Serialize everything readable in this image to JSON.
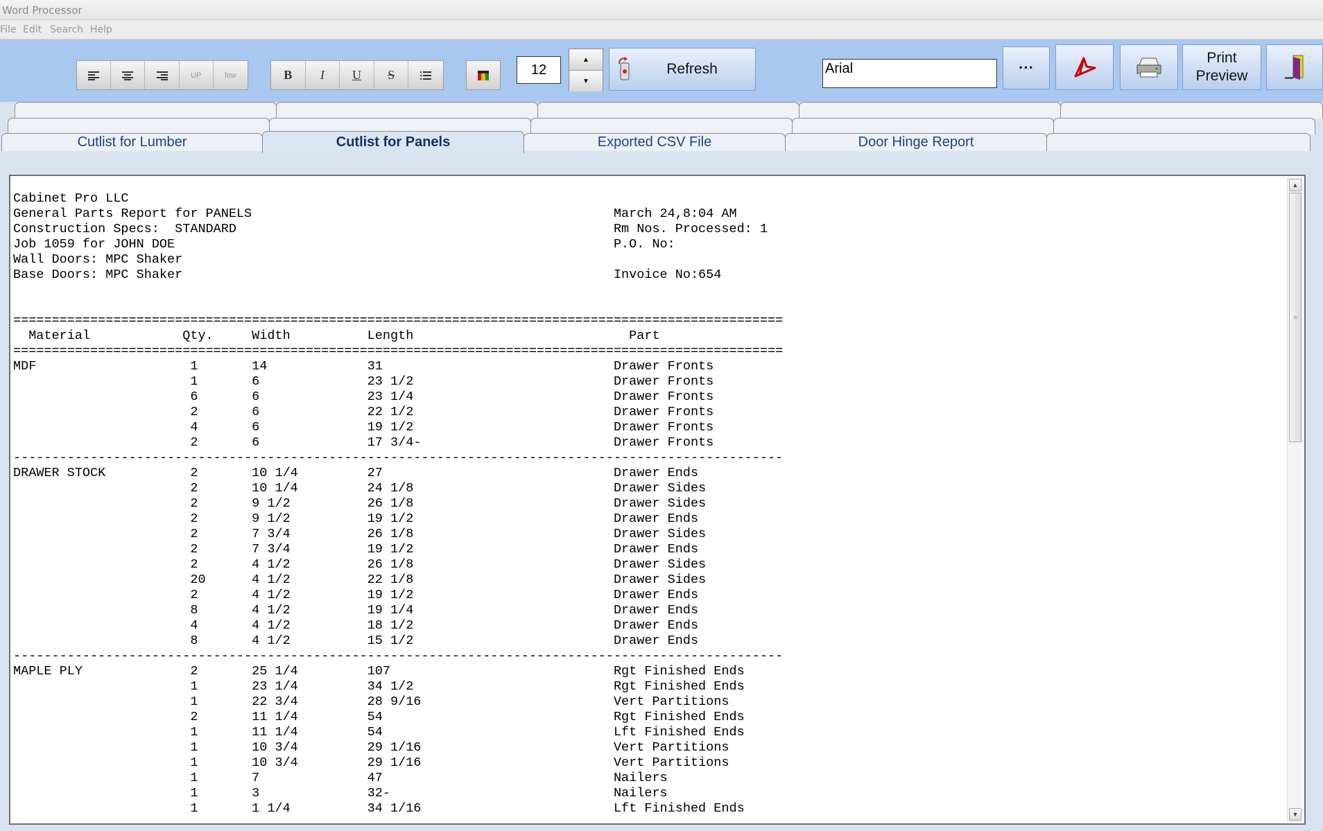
{
  "window": {
    "title": "Word Processor"
  },
  "menu": [
    "File",
    "Edit",
    "Search",
    "Help"
  ],
  "toolbar": {
    "align_buttons": [
      "align-left",
      "align-center",
      "align-right",
      "UP",
      "low"
    ],
    "style_buttons": [
      "B",
      "I",
      "U",
      "S",
      "list"
    ],
    "font_size": "12",
    "refresh_label": "Refresh",
    "font_name": "Arial",
    "more_label": "···",
    "print_preview_label": "Print\nPreview"
  },
  "tabs": {
    "labels": [
      "Cutlist for Lumber",
      "Cutlist for Panels",
      "Exported CSV File",
      "Door Hinge Report"
    ],
    "active": "Cutlist for Panels"
  },
  "report": {
    "header_left": [
      "Cabinet Pro LLC",
      "General Parts Report for PANELS",
      "Construction Specs:  STANDARD",
      "Job 1059 for JOHN DOE",
      "Wall Doors: MPC Shaker",
      "Base Doors: MPC Shaker"
    ],
    "date": "March 24,8:04 AM",
    "rooms_processed": "Rm Nos. Processed: 1",
    "po": "P.O. No:",
    "invoice": "Invoice No:654",
    "columns": [
      "Material",
      "Qty.",
      "Width",
      "Length",
      "Part"
    ],
    "groups": [
      {
        "material": "MDF",
        "rows": [
          [
            "1",
            "14",
            "31",
            "Drawer Fronts"
          ],
          [
            "1",
            "6",
            "23 1/2",
            "Drawer Fronts"
          ],
          [
            "6",
            "6",
            "23 1/4",
            "Drawer Fronts"
          ],
          [
            "2",
            "6",
            "22 1/2",
            "Drawer Fronts"
          ],
          [
            "4",
            "6",
            "19 1/2",
            "Drawer Fronts"
          ],
          [
            "2",
            "6",
            "17 3/4-",
            "Drawer Fronts"
          ]
        ]
      },
      {
        "material": "DRAWER STOCK",
        "rows": [
          [
            "2",
            "10 1/4",
            "27",
            "Drawer Ends"
          ],
          [
            "2",
            "10 1/4",
            "24 1/8",
            "Drawer Sides"
          ],
          [
            "2",
            "9 1/2",
            "26 1/8",
            "Drawer Sides"
          ],
          [
            "2",
            "9 1/2",
            "19 1/2",
            "Drawer Ends"
          ],
          [
            "2",
            "7 3/4",
            "26 1/8",
            "Drawer Sides"
          ],
          [
            "2",
            "7 3/4",
            "19 1/2",
            "Drawer Ends"
          ],
          [
            "2",
            "4 1/2",
            "26 1/8",
            "Drawer Sides"
          ],
          [
            "20",
            "4 1/2",
            "22 1/8",
            "Drawer Sides"
          ],
          [
            "2",
            "4 1/2",
            "19 1/2",
            "Drawer Ends"
          ],
          [
            "8",
            "4 1/2",
            "19 1/4",
            "Drawer Ends"
          ],
          [
            "4",
            "4 1/2",
            "18 1/2",
            "Drawer Ends"
          ],
          [
            "8",
            "4 1/2",
            "15 1/2",
            "Drawer Ends"
          ]
        ]
      },
      {
        "material": "MAPLE PLY",
        "rows": [
          [
            "2",
            "25 1/4",
            "107",
            "Rgt Finished Ends"
          ],
          [
            "1",
            "23 1/4",
            "34 1/2",
            "Rgt Finished Ends"
          ],
          [
            "1",
            "22 3/4",
            "28 9/16",
            "Vert Partitions"
          ],
          [
            "2",
            "11 1/4",
            "54",
            "Rgt Finished Ends"
          ],
          [
            "1",
            "11 1/4",
            "54",
            "Lft Finished Ends"
          ],
          [
            "1",
            "10 3/4",
            "29 1/16",
            "Vert Partitions"
          ],
          [
            "1",
            "10 3/4",
            "29 1/16",
            "Vert Partitions"
          ],
          [
            "1",
            "7",
            "47",
            "Nailers"
          ],
          [
            "1",
            "3",
            "32-",
            "Nailers"
          ],
          [
            "1",
            "1 1/4",
            "34 1/16",
            "Lft Finished Ends"
          ]
        ]
      }
    ]
  }
}
